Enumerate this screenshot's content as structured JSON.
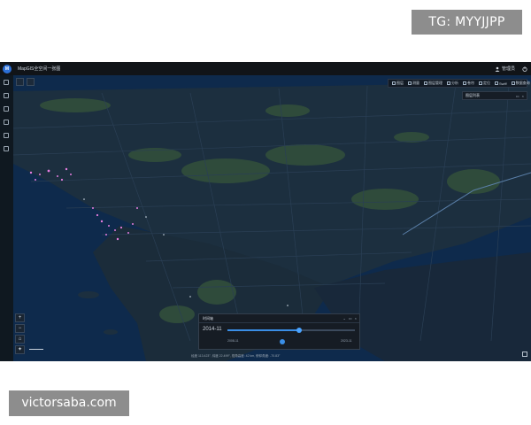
{
  "overlay": {
    "top_badge": "TG: MYYJJPP",
    "bottom_badge": "victorsaba.com"
  },
  "app": {
    "logo_text": "M",
    "title": "MapGIS全空间一张图",
    "user": "管理员"
  },
  "toolbar": {
    "items": [
      "图层",
      "测量",
      "图层管理",
      "分析",
      "卷帘",
      "定位",
      "Swiff",
      "数据查询"
    ]
  },
  "mini_panel": {
    "title": "图层列表"
  },
  "zoom_controls": {
    "zoom_in": "+",
    "zoom_out": "−"
  },
  "time_panel": {
    "title": "时间轴",
    "date": "2014-11",
    "progress": 0.56,
    "knob_label_left": "2008-11",
    "knob_label_right": "2023-11"
  },
  "status": {
    "text": "经度 113.423°, 纬度 22.499°, 视角高度: 42 km, 俯仰角度: -70.83°"
  },
  "colors": {
    "water": "#0e2a4c",
    "land": "#1c2f3f",
    "green": "#2f4b3b",
    "accent": "#3a8ee6",
    "hotspot": "#e67de0"
  }
}
